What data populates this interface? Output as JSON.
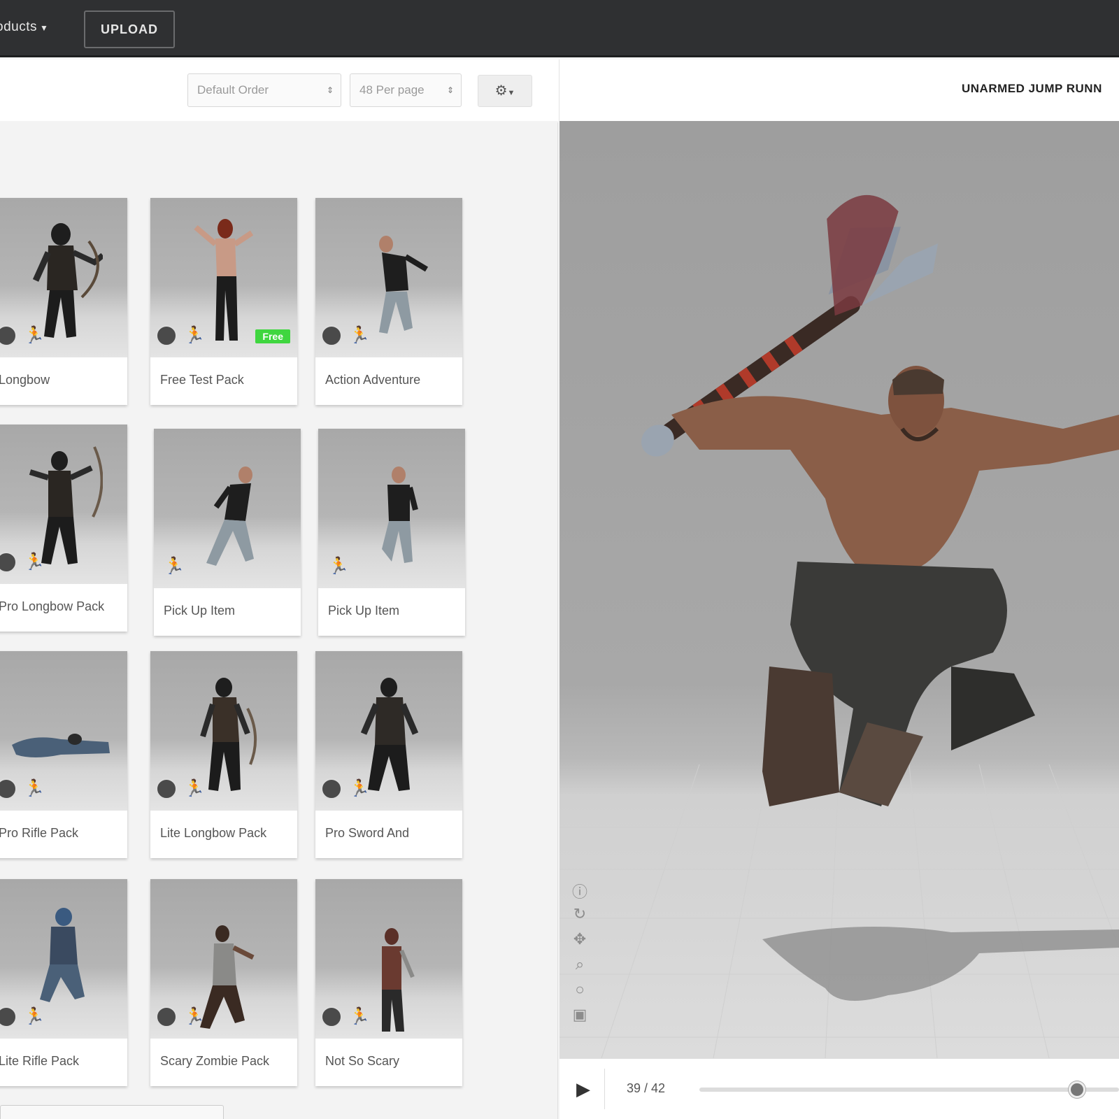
{
  "topbar": {
    "products_label": "oducts",
    "upload_label": "UPLOAD"
  },
  "toolbar": {
    "order_select": "Default Order",
    "per_page_select": "48 Per page",
    "gear_icon": "gear-icon"
  },
  "cards": [
    {
      "label": "Longbow",
      "badge": "",
      "free": ""
    },
    {
      "label": "Free Test Pack",
      "badge": "",
      "free": "Free"
    },
    {
      "label": "Action Adventure",
      "badge": "",
      "free": ""
    },
    {
      "label": "Pro Longbow Pack",
      "badge": "",
      "free": ""
    },
    {
      "label": "Pick Up Item",
      "badge": "",
      "free": ""
    },
    {
      "label": "Pick Up Item",
      "badge": "",
      "free": ""
    },
    {
      "label": "Pro Rifle Pack",
      "badge": "",
      "free": ""
    },
    {
      "label": "Lite Longbow Pack",
      "badge": "",
      "free": ""
    },
    {
      "label": "Pro Sword And",
      "badge": "",
      "free": ""
    },
    {
      "label": "Lite Rifle Pack",
      "badge": "",
      "free": ""
    },
    {
      "label": "Scary Zombie Pack",
      "badge": "",
      "free": ""
    },
    {
      "label": "Not So Scary",
      "badge": "",
      "free": ""
    }
  ],
  "viewer": {
    "title": "UNARMED JUMP RUNN",
    "frame_counter": "39 / 42",
    "progress": 0.9
  },
  "colors": {
    "topbar": "#2f3032",
    "free_badge": "#3fd63f",
    "viewer_bg": "#a8a8a8"
  }
}
